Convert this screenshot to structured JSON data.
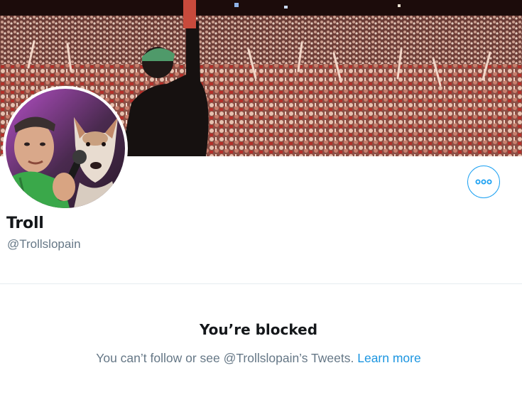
{
  "profile": {
    "display_name": "Troll",
    "handle": "@Trollslopain"
  },
  "blocked_notice": {
    "title": "You’re blocked",
    "message": "You can’t follow or see @Trollslopain’s Tweets.",
    "link_label": "Learn more"
  },
  "colors": {
    "accent": "#1da1f2",
    "link": "#1b95e0",
    "text_primary": "#14171a",
    "text_secondary": "#657786",
    "divider": "#e6ecf0"
  },
  "icons": {
    "more": "more-horizontal-icon"
  }
}
